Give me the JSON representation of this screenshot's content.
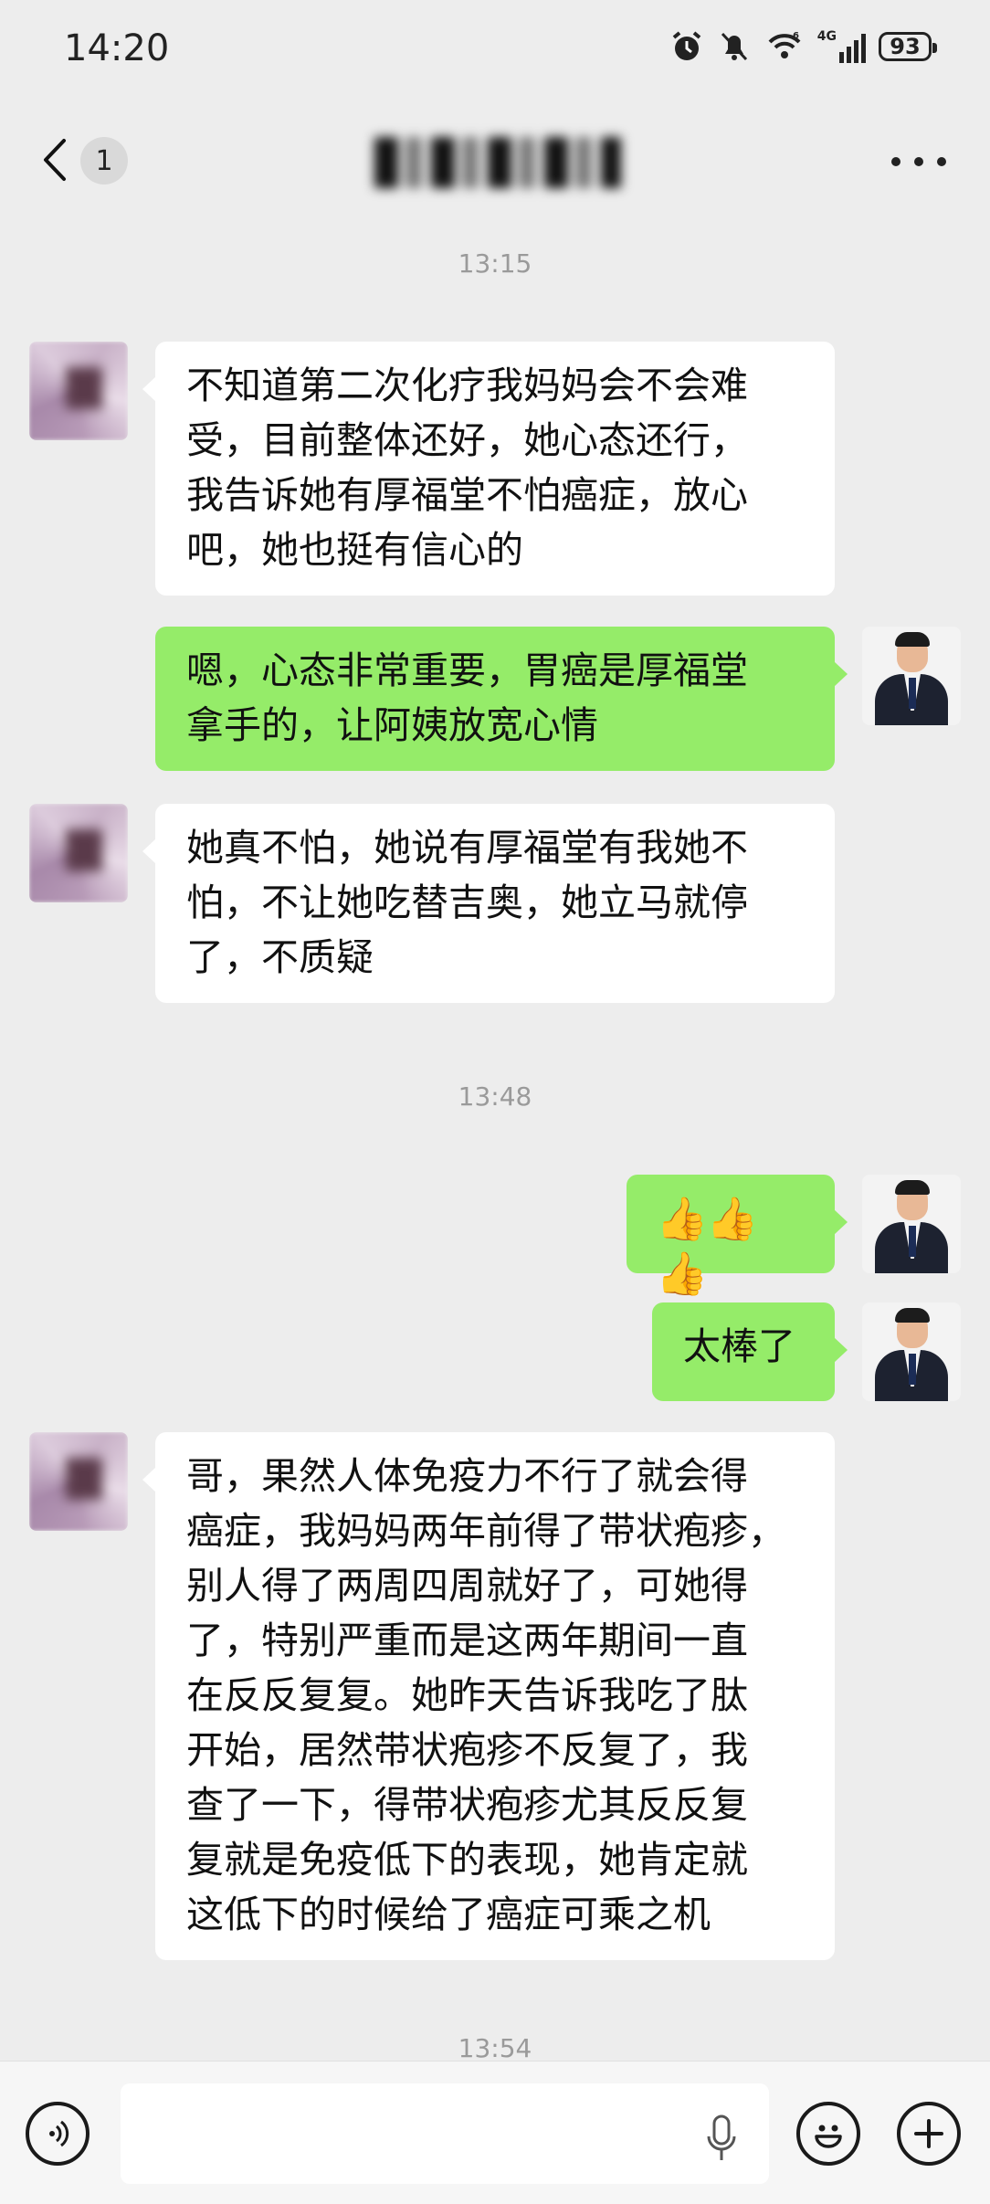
{
  "status_bar": {
    "time": "14:20",
    "network_label": "4G",
    "wifi_label": "6",
    "battery": "93",
    "icons": [
      "alarm-icon",
      "mute-bell-icon",
      "wifi-icon",
      "signal-icon",
      "battery-icon"
    ]
  },
  "nav": {
    "back_count": "1",
    "title": "",
    "icons": [
      "back-chevron-icon",
      "more-dots-icon"
    ]
  },
  "messages": [
    {
      "type": "timestamp",
      "text": "13:15"
    },
    {
      "type": "received",
      "text": "不知道第二次化疗我妈妈会不会难\n受，目前整体还好，她心态还行，\n我告诉她有厚福堂不怕癌症，放心\n吧，她也挺有信心的"
    },
    {
      "type": "sent",
      "text": "嗯，心态非常重要，胃癌是厚福堂\n拿手的，让阿姨放宽心情"
    },
    {
      "type": "received",
      "text": "她真不怕，她说有厚福堂有我她不\n怕，不让她吃替吉奥，她立马就停\n了，不质疑"
    },
    {
      "type": "timestamp",
      "text": "13:48"
    },
    {
      "type": "sent",
      "text": "👍👍👍"
    },
    {
      "type": "sent",
      "text": "太棒了"
    },
    {
      "type": "received",
      "text": "哥，果然人体免疫力不行了就会得\n癌症，我妈妈两年前得了带状疱疹，\n别人得了两周四周就好了，可她得\n了，特别严重而是这两年期间一直\n在反反复复。她昨天告诉我吃了肽\n开始，居然带状疱疹不反复了，我\n查了一下，得带状疱疹尤其反反复\n复就是免疫低下的表现，她肯定就\n这低下的时候给了癌症可乘之机"
    },
    {
      "type": "timestamp",
      "text": "13:54"
    }
  ],
  "input_bar": {
    "value": "",
    "placeholder": "",
    "icons": [
      "voice-icon",
      "mic-icon",
      "emoji-icon",
      "plus-icon"
    ]
  },
  "colors": {
    "background": "#ededed",
    "sent_bubble": "#95ec69",
    "received_bubble": "#ffffff",
    "timestamp": "#9a9a9a"
  }
}
